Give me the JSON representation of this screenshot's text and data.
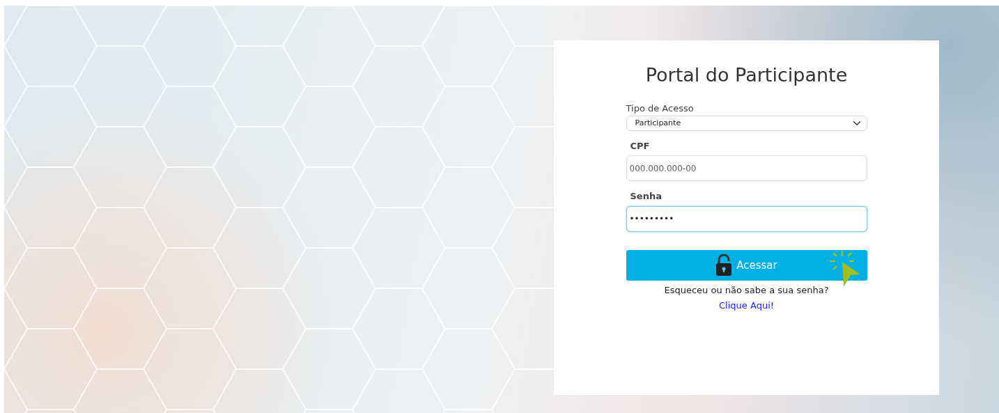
{
  "login": {
    "title": "Portal do Participante",
    "access_type": {
      "label": "Tipo de Acesso",
      "value": "Participante"
    },
    "cpf": {
      "label": "CPF",
      "placeholder": "000.000.000-00"
    },
    "password": {
      "label": "Senha",
      "value": "•••••••••",
      "focused": true
    },
    "submit": {
      "label": "Acessar"
    },
    "forgot_text": "Esqueceu ou não sabe a sua senha?",
    "forgot_link": "Clique Aqui!"
  }
}
